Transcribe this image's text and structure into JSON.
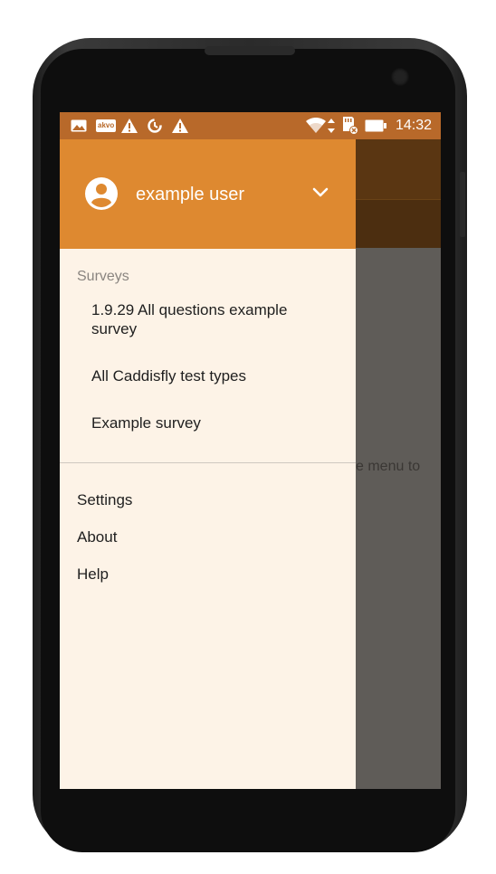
{
  "status_bar": {
    "icons": [
      "image-icon",
      "akvo-icon",
      "warning-icon",
      "sync-icon",
      "warning-icon",
      "wifi-icon",
      "sd-card-icon",
      "battery-icon"
    ],
    "akvo_badge": "akvo",
    "time": "14:32"
  },
  "drawer": {
    "user": {
      "name": "example user",
      "avatar_icon": "account-circle-icon",
      "expand_icon": "chevron-down-icon"
    },
    "surveys_section_label": "Surveys",
    "surveys": [
      {
        "label": "1.9.29 All questions example survey"
      },
      {
        "label": "All Caddisfly test types"
      },
      {
        "label": "Example survey"
      }
    ],
    "menu": [
      {
        "label": "Settings"
      },
      {
        "label": "About"
      },
      {
        "label": "Help"
      }
    ]
  },
  "background": {
    "hint_fragment": "e menu to"
  },
  "colors": {
    "status_bar": "#b8692a",
    "drawer_header": "#de8930",
    "drawer_bg": "#fdf3e7",
    "scrim": "#5f5c58"
  }
}
